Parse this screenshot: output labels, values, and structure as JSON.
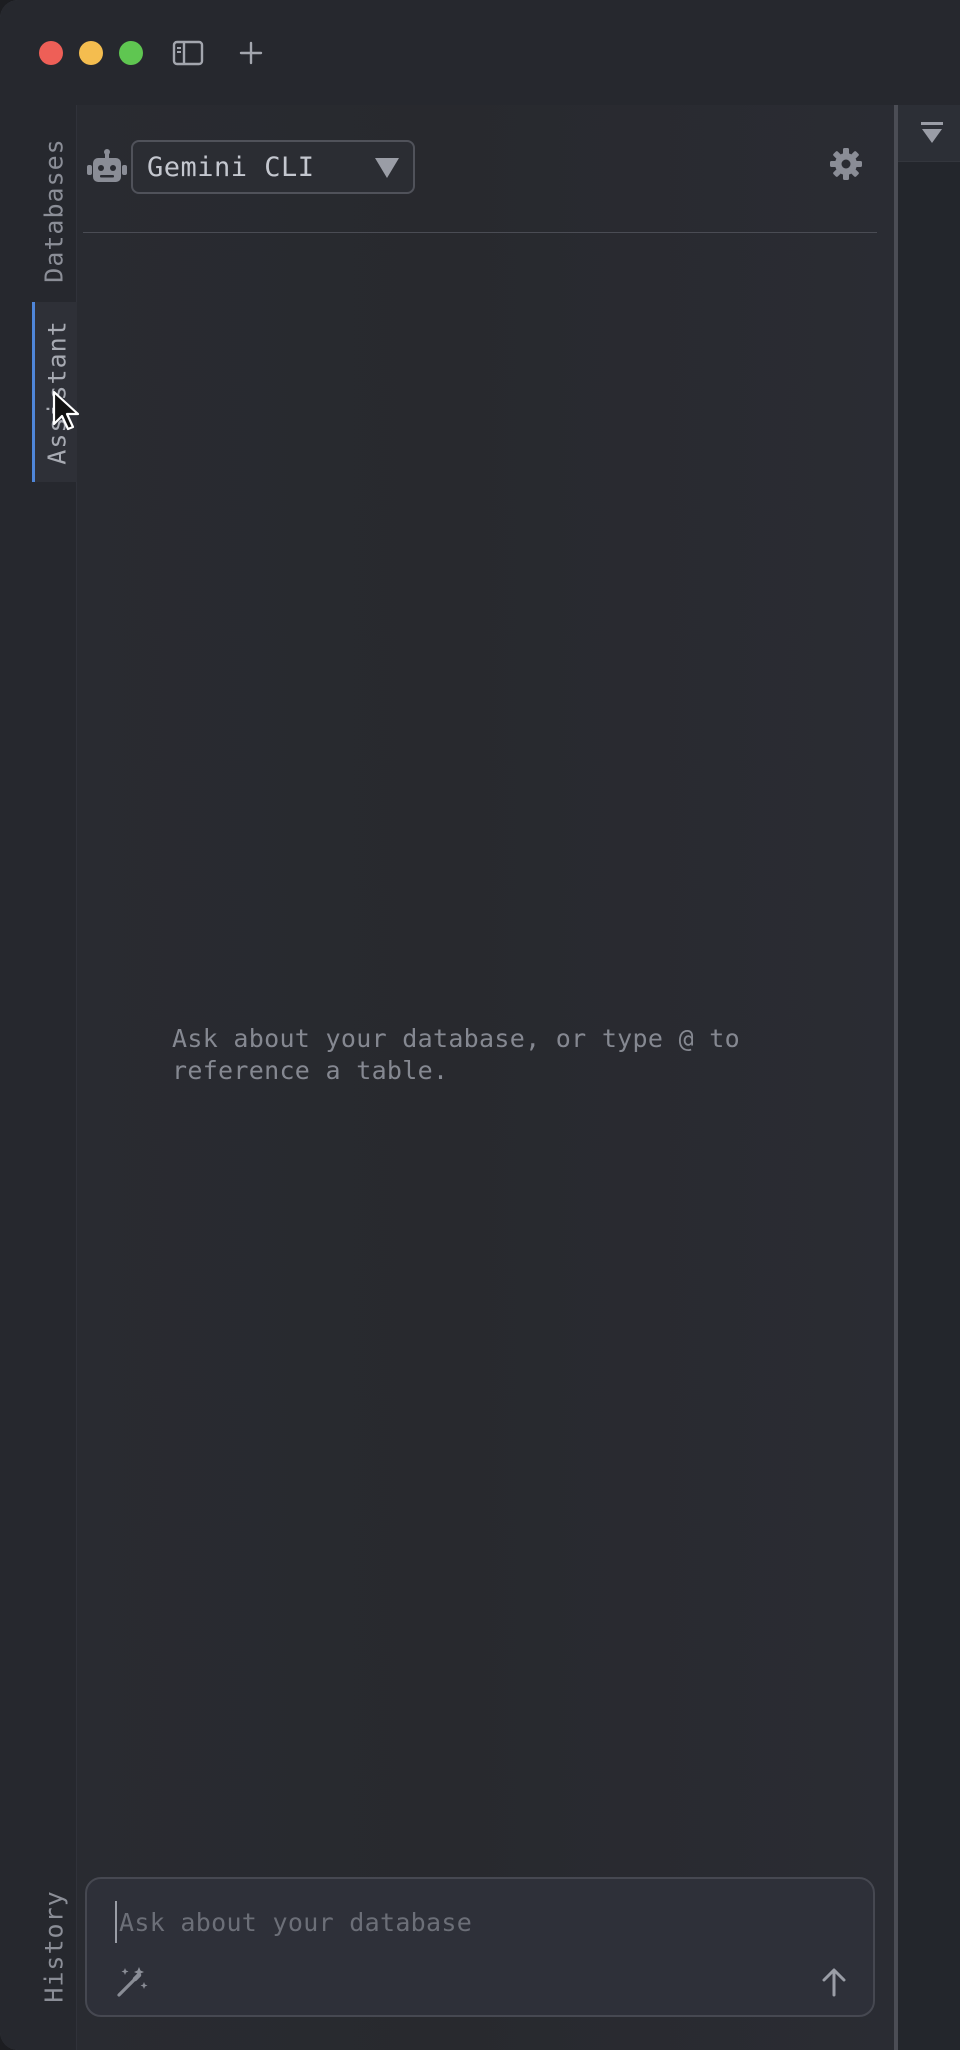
{
  "window": {
    "traffic_lights": [
      "close",
      "minimize",
      "zoom"
    ],
    "toolbar_icons": [
      "sidebar-toggle-icon",
      "plus-icon"
    ]
  },
  "rail": {
    "tabs": [
      {
        "label": "Databases",
        "active": false
      },
      {
        "label": "Assistant",
        "active": true
      },
      {
        "label": "History",
        "active": false
      }
    ]
  },
  "assistant": {
    "agent_icon": "robot-icon",
    "agent_selected": "Gemini CLI",
    "settings_icon": "gear-icon",
    "empty_state": "Ask about your database, or type @ to reference a table.",
    "composer": {
      "placeholder": "Ask about your database",
      "value": ""
    }
  },
  "right_panel": {
    "toolbar_icon": "filter-icon"
  },
  "colors": {
    "accent": "#4f86d9",
    "close": "#ee5f57",
    "minimize": "#f4bd4f",
    "zoom": "#5fc651",
    "background": "#26282e"
  }
}
